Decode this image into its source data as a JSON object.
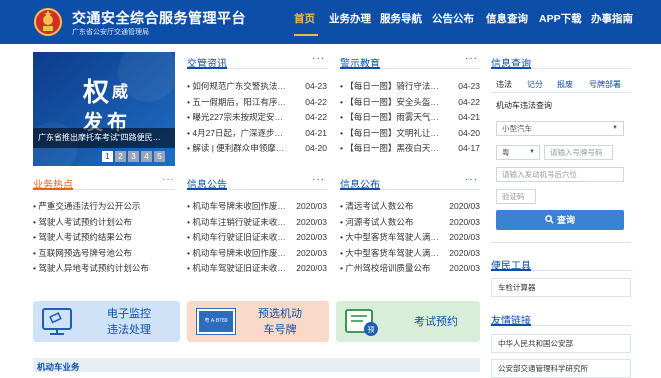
{
  "header": {
    "title": "交通安全综合服务管理平台",
    "subtitle": "广东省公安厅交通管理局",
    "nav": [
      "首页",
      "业务办理",
      "服务导航",
      "公告公布",
      "信息查询",
      "APP下载",
      "办事指南"
    ]
  },
  "banner": {
    "text1": "权",
    "text2": "威",
    "text3": "发",
    "text4": "布",
    "caption": "广东省推出摩托车考试“四路便民…",
    "pages": [
      "1",
      "2",
      "3",
      "4",
      "5"
    ]
  },
  "sections": {
    "traffic_news": {
      "title": "交管资讯",
      "more": "···",
      "items": [
        {
          "t": "• 如何规范广东交警执法…",
          "d": "04-23"
        },
        {
          "t": "• 五一假期后，阳江有序…",
          "d": "04-22"
        },
        {
          "t": "• 曝光227宗未按规定安…",
          "d": "04-22"
        },
        {
          "t": "• 4月27日起，广深逐步…",
          "d": "04-21"
        },
        {
          "t": "• 解读 | 便利群众申领摩…",
          "d": "04-20"
        }
      ]
    },
    "warning_edu": {
      "title": "警示教育",
      "more": "···",
      "items": [
        {
          "t": "• 【每日一图】骑行守法…",
          "d": "04-23"
        },
        {
          "t": "• 【每日一图】安全头盔…",
          "d": "04-22"
        },
        {
          "t": "• 【每日一图】雨雾天气…",
          "d": "04-21"
        },
        {
          "t": "• 【每日一图】文明礼让…",
          "d": "04-20"
        },
        {
          "t": "• 【每日一图】黑夜白天…",
          "d": "04-17"
        }
      ]
    },
    "hot_topics": {
      "title": "业务热点",
      "more": "···",
      "items": [
        {
          "t": "• 严重交通违法行为公开公示"
        },
        {
          "t": "• 驾驶人考试预约计划公布"
        },
        {
          "t": "• 驾驶人考试预约结果公布"
        },
        {
          "t": "• 互联网预选号牌号池公布"
        },
        {
          "t": "• 驾驶人异地考试预约计划公布"
        }
      ]
    },
    "info_notice": {
      "title": "信息公告",
      "more": "···",
      "items": [
        {
          "t": "• 机动车号牌未收回作废…",
          "d": "2020/03"
        },
        {
          "t": "• 机动车注销行驶证未收…",
          "d": "2020/03"
        },
        {
          "t": "• 机动车行驶证旧证未收…",
          "d": "2020/03"
        },
        {
          "t": "• 机动车号牌未收回作废…",
          "d": "2020/03"
        },
        {
          "t": "• 机动车驾驶证旧证未收…",
          "d": "2020/03"
        }
      ]
    },
    "info_publish": {
      "title": "信息公布",
      "more": "···",
      "items": [
        {
          "t": "• 清远考试人数公布",
          "d": "2020/03"
        },
        {
          "t": "• 河源考试人数公布",
          "d": "2020/03"
        },
        {
          "t": "• 大中型客货车驾驶人满…",
          "d": "2020/03"
        },
        {
          "t": "• 大中型客货车驾驶人满…",
          "d": "2020/03"
        },
        {
          "t": "• 广州驾校培训质量公布",
          "d": "2020/03"
        }
      ]
    }
  },
  "cards": {
    "monitor": {
      "line1": "电子监控",
      "line2": "违法处理"
    },
    "plate": {
      "line1": "预选机动",
      "line2": "车号牌",
      "tag": "粤 A·B789"
    },
    "exam": {
      "line1": "考试预约",
      "badge": "预"
    }
  },
  "info_query": {
    "title": "信息查询",
    "tabs": [
      "违法",
      "记分",
      "报废",
      "号牌部署"
    ],
    "heading": "机动车违法查询",
    "vehicle_type": "小型汽车",
    "province": "粤",
    "plate_placeholder": "请输入号牌号码",
    "engine_placeholder": "请输入发动机号后六位",
    "captcha_placeholder": "验证码",
    "query_label": "查询"
  },
  "tools": {
    "title": "便民工具",
    "items": [
      "车检计算器"
    ]
  },
  "links": {
    "title": "友情链接",
    "items": [
      "中华人民共和国公安部",
      "公安部交通管理科学研究所"
    ]
  },
  "bottom": {
    "title": "机动车业务"
  },
  "colors": {
    "header_bg": "#0d4fa8",
    "nav_active": "#f3b84a",
    "accent_orange": "#e2631a",
    "query_btn": "#3b82d4"
  }
}
